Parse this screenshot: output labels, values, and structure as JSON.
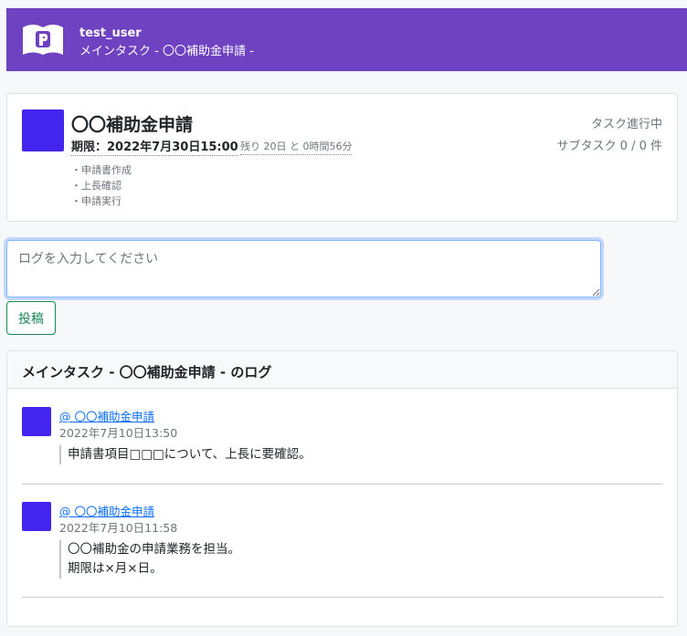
{
  "header": {
    "user_name": "test_user",
    "subtitle": "メインタスク - 〇〇補助金申請 -"
  },
  "task": {
    "title": "〇〇補助金申請",
    "deadline": "期限：2022年7月30日15:00",
    "remaining": "残り 20日 と 0時間56分",
    "status": "タスク進行中",
    "subtasks": "サブタスク 0 / 0 件",
    "steps": [
      "・申請書作成",
      "・上長確認",
      "・申請実行"
    ]
  },
  "log_form": {
    "placeholder": "ログを入力してください",
    "submit_label": "投稿"
  },
  "log_section": {
    "title": "メインタスク - 〇〇補助金申請 - のログ",
    "entries": [
      {
        "author": "@ 〇〇補助金申請",
        "timestamp": "2022年7月10日13:50",
        "body": [
          "申請書項目□□□について、上長に要確認。"
        ]
      },
      {
        "author": "@ 〇〇補助金申請",
        "timestamp": "2022年7月10日11:58",
        "body": [
          "〇〇補助金の申請業務を担当。",
          "期限は×月×日。"
        ]
      }
    ]
  },
  "colors": {
    "brand": "#6f42c1",
    "avatar": "#4425f0",
    "link": "#0d6efd",
    "success": "#198754"
  },
  "icons": {
    "logo": "book-p-logo-icon"
  }
}
